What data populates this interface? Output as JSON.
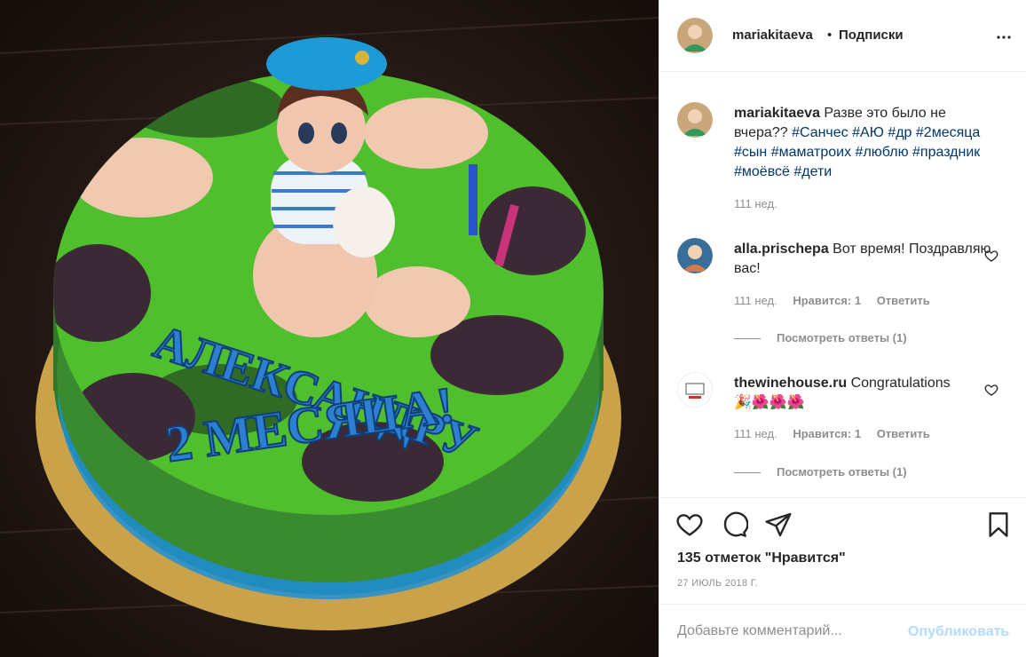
{
  "photo": {
    "alt_icon": "cake-photo",
    "cake_text_line1": "АЛЕКСАНДРУ",
    "cake_text_line2": "2 МЕСЯЦА!"
  },
  "header": {
    "username": "mariakitaeva",
    "dot": "•",
    "follow_label": "Подписки",
    "more_icon": "more-horizontal-icon"
  },
  "caption": {
    "username": "mariakitaeva",
    "text": "Разве это было не вчера??",
    "hashtags": [
      "#Санчес",
      "#АЮ",
      "#др",
      "#2месяца",
      "#сын",
      "#маматроих",
      "#люблю",
      "#праздник",
      "#моёвсё",
      "#дети"
    ],
    "time": "111 нед."
  },
  "comments": [
    {
      "username": "alla.prischepa",
      "text": "Вот время! Поздравляю вас!",
      "time": "111 нед.",
      "likes": "Нравится: 1",
      "reply": "Ответить",
      "view_replies": "Посмотреть ответы (1)"
    },
    {
      "username": "thewinehouse.ru",
      "text": "Congratulations",
      "emoji": "🎉🌺🌺🌺",
      "time": "111 нед.",
      "likes": "Нравится: 1",
      "reply": "Ответить",
      "view_replies": "Посмотреть ответы (1)"
    }
  ],
  "actions": {
    "like_icon": "heart-icon",
    "comment_icon": "comment-icon",
    "share_icon": "share-icon",
    "save_icon": "bookmark-icon",
    "likes_text": "135 отметок \"Нравится\"",
    "date": "27 ИЮЛЬ 2018 Г."
  },
  "comment_form": {
    "placeholder": "Добавьте комментарий...",
    "publish_label": "Опубликовать"
  },
  "colors": {
    "link": "#00376b",
    "muted": "#8e8e8e",
    "publish_disabled": "#b3dbff",
    "text": "#262626"
  }
}
